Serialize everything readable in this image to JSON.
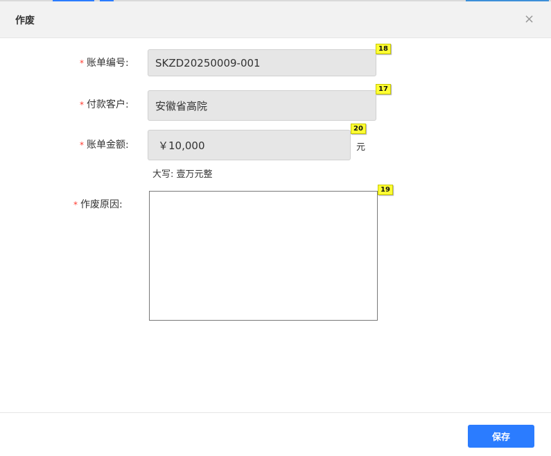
{
  "dialog": {
    "title": "作废",
    "close_symbol": "×"
  },
  "form": {
    "required_mark": "*",
    "bill_no": {
      "label": "账单编号:",
      "value": "SKZD20250009-001",
      "badge": "18"
    },
    "customer": {
      "label": "付款客户:",
      "value": "安徽省高院",
      "badge": "17"
    },
    "amount": {
      "label": "账单金额:",
      "value": "￥10,000",
      "badge": "20",
      "unit": "元",
      "uppercase": "大写: 壹万元整"
    },
    "reason": {
      "label": "作废原因:",
      "value": "",
      "badge": "19"
    }
  },
  "footer": {
    "save_label": "保存"
  },
  "colors": {
    "primary": "#2b7cff",
    "required": "#ff3b30",
    "badge": "#ffff33",
    "readonly_bg": "#e6e6e6"
  }
}
